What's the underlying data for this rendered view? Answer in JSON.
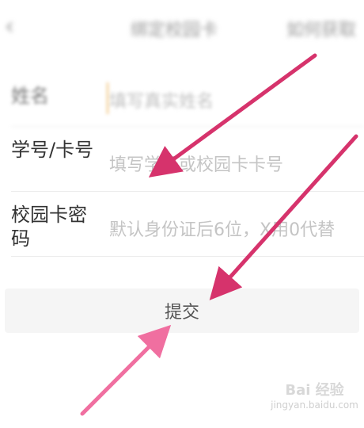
{
  "header": {
    "back_icon": "chevron-left-icon",
    "title": "绑定校园卡",
    "right_action": "如何获取"
  },
  "form": {
    "name": {
      "label": "姓名",
      "placeholder": "填写真实姓名"
    },
    "student_id": {
      "label": "学号/卡号",
      "placeholder": "填写学号或校园卡卡号"
    },
    "card_password": {
      "label": "校园卡密码",
      "placeholder": "默认身份证后6位，X用0代替"
    }
  },
  "submit_label": "提交",
  "annotations": {
    "arrow_color": "#d6336c",
    "arrow_light_color": "#f06fa0"
  },
  "watermark": {
    "brand": "Bai 经验",
    "url": "jingyan.baidu.com"
  }
}
